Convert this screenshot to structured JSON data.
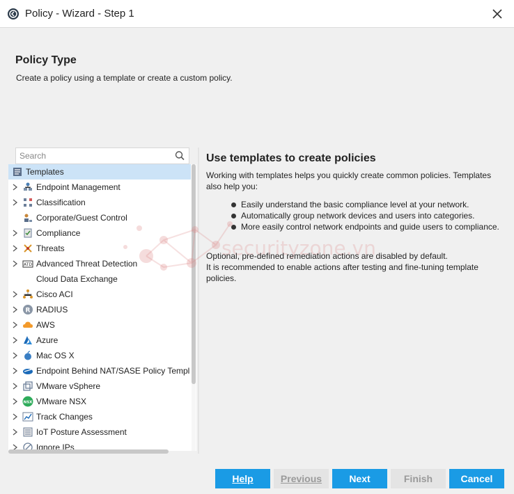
{
  "window": {
    "title": "Policy - Wizard - Step 1"
  },
  "header": {
    "title": "Policy Type",
    "description": "Create a policy using a template or create a custom policy."
  },
  "search": {
    "placeholder": "Search"
  },
  "tree": {
    "root": {
      "label": "Templates",
      "icon": "templates-icon",
      "selected": true
    },
    "items": [
      {
        "label": "Endpoint Management",
        "icon": "endpoint-management-icon",
        "expandable": true
      },
      {
        "label": "Classification",
        "icon": "classification-icon",
        "expandable": true
      },
      {
        "label": "Corporate/Guest Control",
        "icon": "corporate-guest-icon",
        "expandable": false
      },
      {
        "label": "Compliance",
        "icon": "compliance-icon",
        "expandable": true
      },
      {
        "label": "Threats",
        "icon": "threats-icon",
        "expandable": true
      },
      {
        "label": "Advanced Threat Detection",
        "icon": "atd-icon",
        "expandable": true
      },
      {
        "label": "Cloud Data Exchange",
        "icon": "cloud-data-exchange-icon",
        "expandable": false
      },
      {
        "label": "Cisco ACI",
        "icon": "cisco-aci-icon",
        "expandable": true
      },
      {
        "label": "RADIUS",
        "icon": "radius-icon",
        "expandable": true
      },
      {
        "label": "AWS",
        "icon": "aws-icon",
        "expandable": true
      },
      {
        "label": "Azure",
        "icon": "azure-icon",
        "expandable": true
      },
      {
        "label": "Mac OS X",
        "icon": "apple-icon",
        "expandable": true
      },
      {
        "label": "Endpoint Behind NAT/SASE Policy Templ",
        "icon": "nat-sase-icon",
        "expandable": true
      },
      {
        "label": "VMware vSphere",
        "icon": "vmware-vsphere-icon",
        "expandable": true
      },
      {
        "label": "VMware NSX",
        "icon": "vmware-nsx-icon",
        "expandable": true
      },
      {
        "label": "Track Changes",
        "icon": "track-changes-icon",
        "expandable": true
      },
      {
        "label": "IoT Posture Assessment",
        "icon": "iot-posture-icon",
        "expandable": true
      },
      {
        "label": "Ignore IPs",
        "icon": "ignore-ips-icon",
        "expandable": true
      }
    ]
  },
  "details": {
    "title": "Use templates to create policies",
    "intro": "Working with templates helps you quickly create common policies. Templates also help you:",
    "bullets": [
      "Easily understand the basic compliance level at your network.",
      "Automatically group network devices and users into categories.",
      "More easily control network endpoints and guide users to compliance."
    ],
    "note_line1": "Optional, pre-defined remediation actions are disabled by default.",
    "note_line2": "It is recommended to enable actions after testing and fine-tuning template policies."
  },
  "watermark": {
    "text": "securityzone.vn"
  },
  "buttons": {
    "help": "Help",
    "previous": "Previous",
    "next": "Next",
    "finish": "Finish",
    "cancel": "Cancel"
  },
  "colors": {
    "accent": "#1a9be5",
    "selection": "#cce3f7",
    "disabled": "#e4e4e4"
  }
}
